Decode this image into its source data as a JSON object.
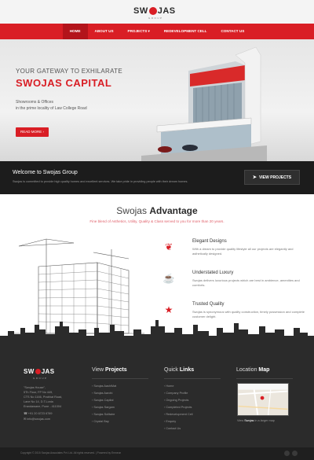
{
  "header": {
    "logo_text_a": "SW",
    "logo_text_b": "JAS",
    "logo_sub": "GROUP"
  },
  "nav": [
    {
      "label": "HOME"
    },
    {
      "label": "ABOUT US"
    },
    {
      "label": "PROJECTS ▾"
    },
    {
      "label": "REDEVELOPMENT CELL"
    },
    {
      "label": "CONTACT US"
    }
  ],
  "hero": {
    "tagline": "YOUR GATEWAY TO EXHILARATE",
    "title": "SWOJAS CAPITAL",
    "line1": "Showrooms & Offices",
    "line2": "in the prime locality of Law College Road",
    "button": "READ MORE ›"
  },
  "welcome": {
    "title": "Welcome to Swojas Group",
    "subtitle": "Swojas is committed to provide high quality homes and excellent services. We take pride in providing people with their dream homes.",
    "button": "VIEW PROJECTS"
  },
  "advantage": {
    "title_a": "Swojas ",
    "title_b": "Advantage",
    "subtitle": "Fine blend of Asthetics, Utility, Quality & Class served to you for more than 20 years.",
    "features": [
      {
        "icon": "leaf-icon",
        "title": "Elegant Designs",
        "text": "With a dream to provide quality lifestyle all our projects are elegantly and asthetically designed."
      },
      {
        "icon": "cup-icon",
        "title": "Understated Luxury",
        "text": "Swojas delivers luxurious projects which are best in ambience, amenities and comforts."
      },
      {
        "icon": "star-icon",
        "title": "Trusted Quality",
        "text": "Swojas is synonymous with quality construction, timely possession and complete customer delight."
      }
    ]
  },
  "footer": {
    "address": [
      "\"Swojas House\",",
      "5Th Floor, FP No 449,",
      "CTS No 1166, Prabhat Road,",
      "Lane No 14, D.T.Lonia",
      "Erandawane, Pune - 411004"
    ],
    "phone": "+91 20 6723 6789",
    "email": "info@swojas.com",
    "projects_title_a": "View ",
    "projects_title_b": "Projects",
    "projects": [
      "› Swojas AashiMat",
      "› Swojas Aarohi",
      "› Swojas Capital",
      "› Swojas Sargam",
      "› Swojas Solitaire",
      "› Crystal Bay"
    ],
    "links_title_a": "Quick ",
    "links_title_b": "Links",
    "links": [
      "› Home",
      "› Company Profile",
      "› Ongoing Projects",
      "› Completed Projects",
      "› Redevelopment Cell",
      "› Enquiry",
      "› Contact Us"
    ],
    "map_title_a": "Location ",
    "map_title_b": "Map",
    "map_caption_a": "View ",
    "map_caption_link": "Swojas",
    "map_caption_b": " in a larger map",
    "copyright": "Copyright © 2015 Swojas Associates Pvt. Ltd. All rights reserved. | Powered by Emneon"
  },
  "colors": {
    "brand_red": "#d91e25",
    "dark": "#1c1c1c",
    "footer": "#2b2b2b"
  }
}
